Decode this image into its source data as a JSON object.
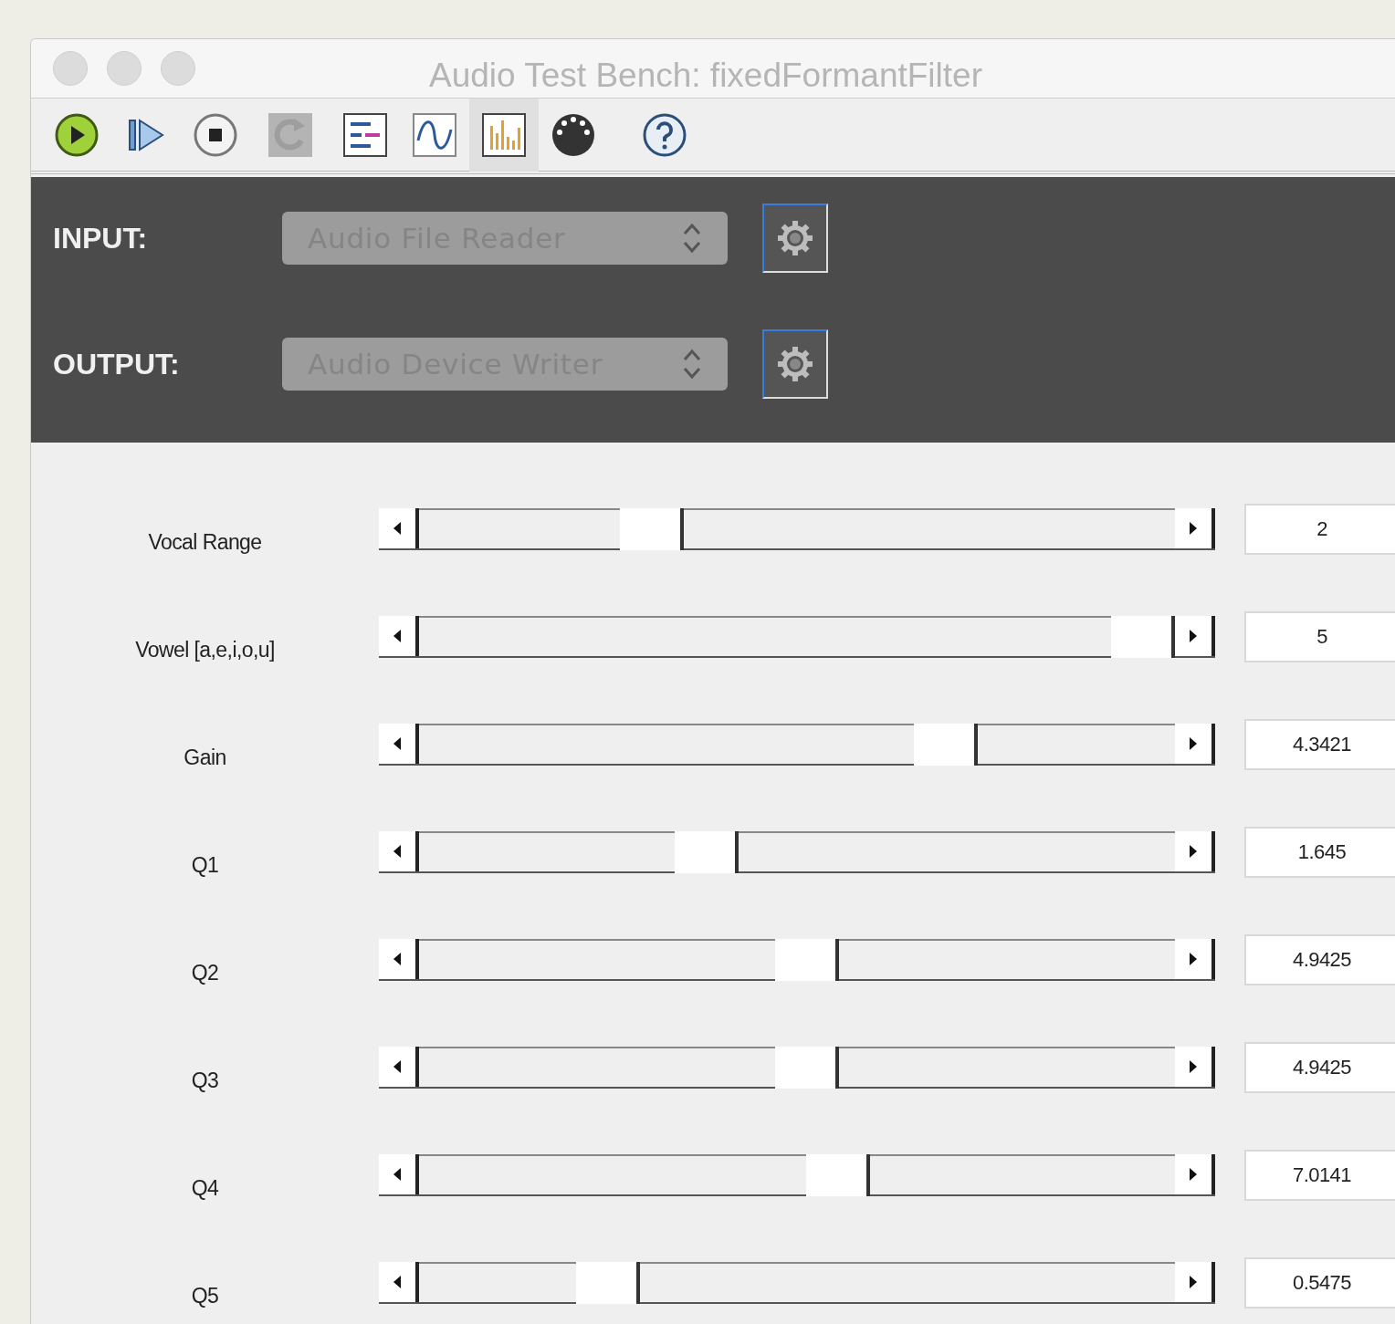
{
  "window": {
    "title": "Audio Test Bench: fixedFormantFilter"
  },
  "toolbar": [
    {
      "kind": "play",
      "selected": false,
      "disabled": false
    },
    {
      "kind": "step",
      "selected": false,
      "disabled": false
    },
    {
      "kind": "stop",
      "selected": false,
      "disabled": false
    },
    {
      "kind": "redo",
      "selected": false,
      "disabled": true
    },
    {
      "kind": "list",
      "selected": false,
      "disabled": false
    },
    {
      "kind": "wave",
      "selected": false,
      "disabled": false
    },
    {
      "kind": "spectrum",
      "selected": true,
      "disabled": false
    },
    {
      "kind": "midi",
      "selected": false,
      "disabled": false
    },
    {
      "kind": "help",
      "selected": false,
      "disabled": false
    }
  ],
  "io": [
    {
      "label": "INPUT:",
      "value": "Audio File Reader"
    },
    {
      "label": "OUTPUT:",
      "value": "Audio Device Writer"
    }
  ],
  "parameters": [
    {
      "name": "Vocal Range",
      "level": 0.29,
      "value": "2"
    },
    {
      "name": "Vowel [a,e,i,o,u]",
      "level": 1.0,
      "value": "5"
    },
    {
      "name": "Gain",
      "level": 0.715,
      "value": "4.3421"
    },
    {
      "name": "Q1",
      "level": 0.37,
      "value": "1.645"
    },
    {
      "name": "Q2",
      "level": 0.515,
      "value": "4.9425"
    },
    {
      "name": "Q3",
      "level": 0.515,
      "value": "4.9425"
    },
    {
      "name": "Q4",
      "level": 0.56,
      "value": "7.0141"
    },
    {
      "name": "Q5",
      "level": 0.227,
      "value": "0.5475"
    }
  ]
}
